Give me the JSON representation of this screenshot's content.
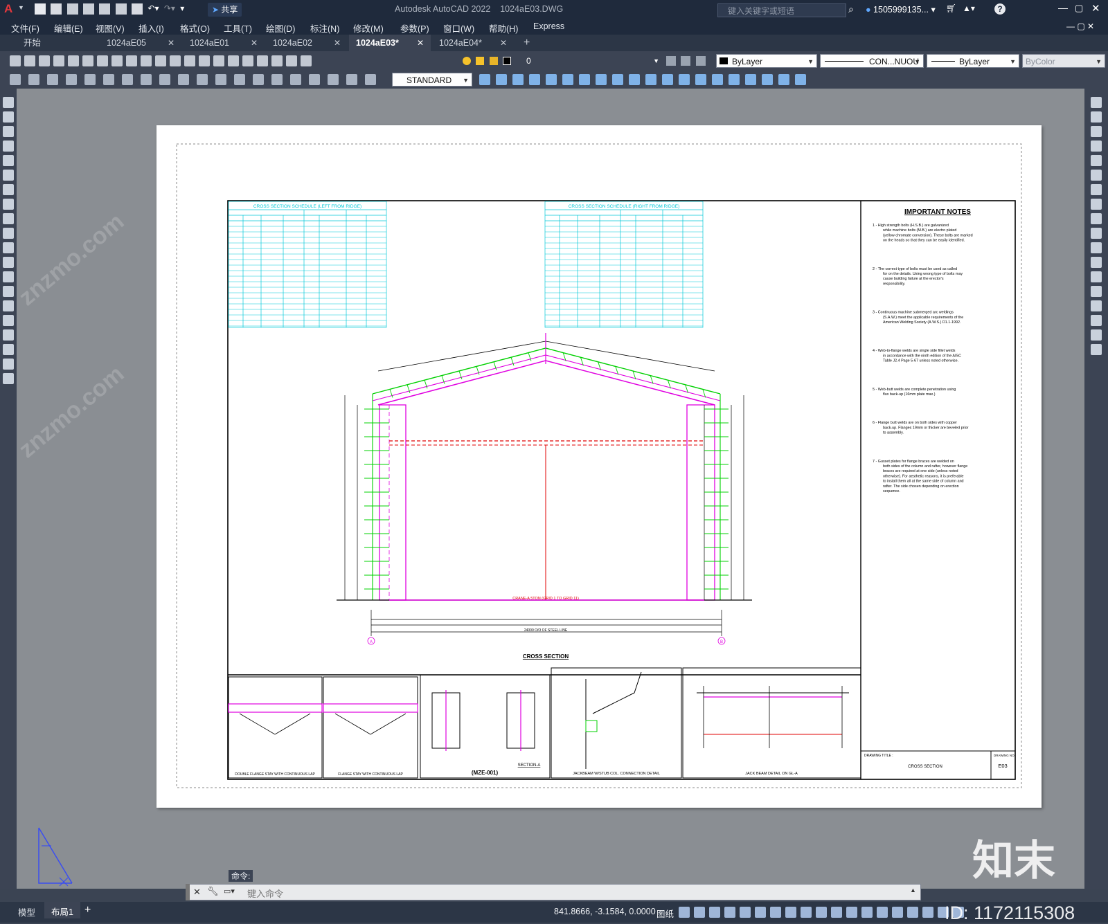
{
  "titlebar": {
    "app_title": "Autodesk AutoCAD 2022",
    "file_name": "1024aE03.DWG",
    "share_label": "共享",
    "search_placeholder": "键入关键字或短语",
    "user": "1505999135...",
    "window_buttons": [
      "minimize-icon",
      "restore-icon",
      "close-icon"
    ]
  },
  "menu": {
    "items": [
      "文件(F)",
      "编辑(E)",
      "视图(V)",
      "插入(I)",
      "格式(O)",
      "工具(T)",
      "绘图(D)",
      "标注(N)",
      "修改(M)",
      "参数(P)",
      "窗口(W)",
      "帮助(H)",
      "Express"
    ]
  },
  "tabs": [
    {
      "label": "开始",
      "active": false
    },
    {
      "label": "1024aE05",
      "active": false
    },
    {
      "label": "1024aE01",
      "active": false
    },
    {
      "label": "1024aE02",
      "active": false
    },
    {
      "label": "1024aE03*",
      "active": true
    },
    {
      "label": "1024aE04*",
      "active": false
    }
  ],
  "properties": {
    "layer": "0",
    "color": "ByLayer",
    "linetype": "CON...NUOU",
    "lineweight": "ByLayer",
    "plotstyle": "ByColor",
    "textstyle": "STANDARD"
  },
  "command": {
    "label": "命令:",
    "placeholder": "键入命令"
  },
  "layout_tabs": [
    "模型",
    "布局1"
  ],
  "status": {
    "coords": "841.8666, -3.1584, 0.0000",
    "paper_label": "图纸"
  },
  "watermark": {
    "brand": "知末",
    "id": "ID: 1172115308"
  },
  "drawing": {
    "schedule_left_title": "CROSS SECTION SCHEDULE (LEFT FROM RIDGE)",
    "schedule_right_title": "CROSS SECTION SCHEDULE (RIGHT FROM RIDGE)",
    "notes_title": "IMPORTANT NOTES",
    "notes": [
      "1 - High strength bolts (H.S.B.) are galvanized while machine bolts (M.B.) are electro plated (yellow chromate conversion). These bolts are marked on the heads so that they can be easily identified.",
      "2 - The correct type of bolts must be used as called for on the details. Using wrong type of bolts may cause building failure at the erector's responsibility.",
      "3 - Continuous machine submerged arc weldings (S.A.W.) meet the applicable requirements of the American Welding Society (A.W.S.) D1.1-1992.",
      "4 - Web-to-flange welds are single side fillet welds in accordance with the ninth edition of the AISC Table J2.4 Page 5-67 unless noted otherwise.",
      "5 - Web-butt welds are complete penetration using flux back-up (16mm plate max.)",
      "6 - Flange butt welds are on both sides with copper back-up. Flanges 19mm or thicker are beveled prior to assembly.",
      "7 - Gusset plates for flange braces are welded on both sides of the column and rafter, however flange braces are required at one side (unless noted otherwise). For aesthetic reasons, it is preferable to install them all at the same side of column and rafter. The side chosen depending on erection sequence."
    ],
    "main_title": "CROSS SECTION",
    "crane_label": "CRANE-A 5TON (GRID 1 TO GRID 11)",
    "dim_bottom": "24000 O/O OF STEEL LINE",
    "grid_a": "A",
    "grid_b": "B",
    "details": [
      "DOUBLE FLANGE STAY WITH CONTINUOUS LAP",
      "FLANGE STAY WITH CONTINUOUS LAP",
      "(MZE-001)",
      "JACKBEAM W/STUB COL. CONNECTION DETAIL",
      "JACK BEAM DETAIL ON GL-A"
    ],
    "section_a": "SECTION-A",
    "title_block": {
      "drawing_title_label": "DRAWING TITLE :",
      "drawing_title": "CROSS SECTION",
      "drawing_no_label": "DRAWING NO.",
      "drawing_no": "E03"
    }
  }
}
